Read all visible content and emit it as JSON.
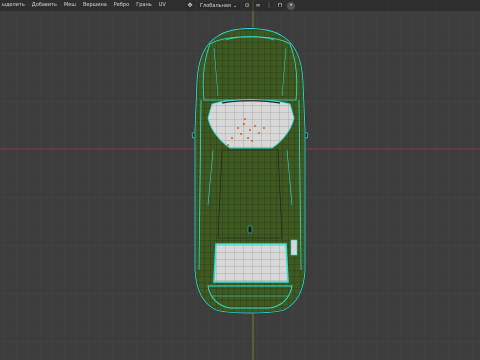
{
  "header": {
    "menu": [
      "ыделить",
      "Добавить",
      "Меш",
      "Вершина",
      "Ребро",
      "Грань",
      "UV"
    ],
    "transform_orientation": "Глобальная",
    "dropdown_arrow": "⌄",
    "icons": [
      "transform-pivot-icon",
      "link-icon",
      "snap-icon",
      "magnet-icon",
      "proportional-edit-icon"
    ]
  },
  "colors": {
    "background": "#3d3d3d",
    "grid_minor": "#454545",
    "grid_major": "#4c4c4c",
    "axis_x": "#8a3a44",
    "axis_y": "#6f8a2e",
    "mesh_face": "#3e5a1e",
    "mesh_edge": "#1e1e1e",
    "selected_edge": "#33e0d8",
    "selected_face": "#d7d7d7",
    "vertex_dot": "#e05a1a"
  }
}
